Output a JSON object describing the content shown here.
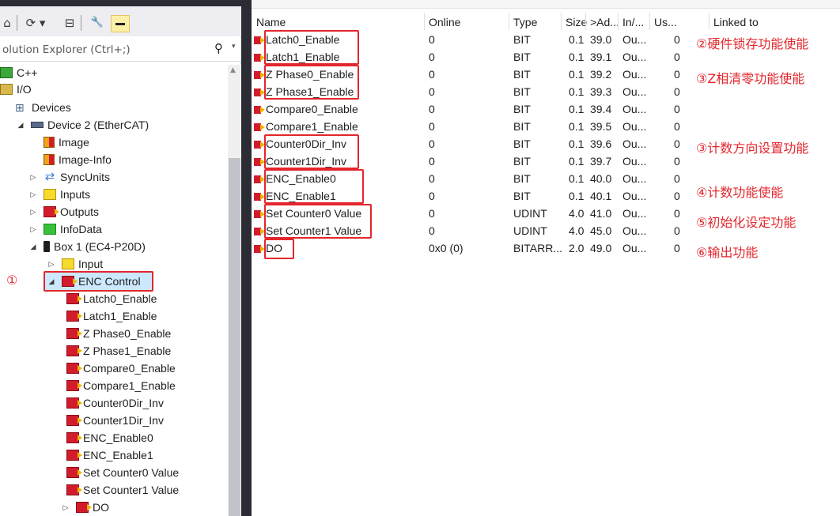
{
  "toolbar": {
    "home": "⌂",
    "history": "⟳ ▾",
    "collapse": "⊟",
    "properties": "🔧"
  },
  "search": {
    "placeholder": "olution Explorer (Ctrl+;)"
  },
  "tree": [
    {
      "label": "C++",
      "icon": "cpp-icon"
    },
    {
      "label": "I/O",
      "icon": "io-icon"
    },
    {
      "label": "Devices",
      "icon": "devices-icon"
    },
    {
      "label": "Device 2 (EtherCAT)",
      "icon": "device-icon"
    },
    {
      "label": "Image",
      "icon": "image-icon"
    },
    {
      "label": "Image-Info",
      "icon": "image-info-icon"
    },
    {
      "label": "SyncUnits",
      "icon": "sync-icon"
    },
    {
      "label": "Inputs",
      "icon": "inputs-icon"
    },
    {
      "label": "Outputs",
      "icon": "outputs-icon"
    },
    {
      "label": "InfoData",
      "icon": "infodata-icon"
    },
    {
      "label": "Box 1 (EC4-P20D)",
      "icon": "box-icon"
    },
    {
      "label": "Input",
      "icon": "input-icon"
    },
    {
      "label": "ENC Control",
      "icon": "enc-control-icon"
    },
    {
      "label": "Latch0_Enable",
      "icon": "output-var-icon"
    },
    {
      "label": "Latch1_Enable",
      "icon": "output-var-icon"
    },
    {
      "label": "Z Phase0_Enable",
      "icon": "output-var-icon"
    },
    {
      "label": "Z Phase1_Enable",
      "icon": "output-var-icon"
    },
    {
      "label": "Compare0_Enable",
      "icon": "output-var-icon"
    },
    {
      "label": "Compare1_Enable",
      "icon": "output-var-icon"
    },
    {
      "label": "Counter0Dir_Inv",
      "icon": "output-var-icon"
    },
    {
      "label": "Counter1Dir_Inv",
      "icon": "output-var-icon"
    },
    {
      "label": "ENC_Enable0",
      "icon": "output-var-icon"
    },
    {
      "label": "ENC_Enable1",
      "icon": "output-var-icon"
    },
    {
      "label": "Set Counter0 Value",
      "icon": "output-var-icon"
    },
    {
      "label": "Set Counter1 Value",
      "icon": "output-var-icon"
    },
    {
      "label": "DO",
      "icon": "output-var-icon"
    }
  ],
  "annotation_left": "①",
  "table": {
    "headers": [
      "Name",
      "Online",
      "Type",
      "Size",
      ">Ad...",
      "In/...",
      "Us...",
      "Linked to"
    ],
    "rows": [
      [
        "Latch0_Enable",
        "0",
        "BIT",
        "0.1",
        "39.0",
        "Ou...",
        "0"
      ],
      [
        "Latch1_Enable",
        "0",
        "BIT",
        "0.1",
        "39.1",
        "Ou...",
        "0"
      ],
      [
        "Z Phase0_Enable",
        "0",
        "BIT",
        "0.1",
        "39.2",
        "Ou...",
        "0"
      ],
      [
        "Z Phase1_Enable",
        "0",
        "BIT",
        "0.1",
        "39.3",
        "Ou...",
        "0"
      ],
      [
        "Compare0_Enable",
        "0",
        "BIT",
        "0.1",
        "39.4",
        "Ou...",
        "0"
      ],
      [
        "Compare1_Enable",
        "0",
        "BIT",
        "0.1",
        "39.5",
        "Ou...",
        "0"
      ],
      [
        "Counter0Dir_Inv",
        "0",
        "BIT",
        "0.1",
        "39.6",
        "Ou...",
        "0"
      ],
      [
        "Counter1Dir_Inv",
        "0",
        "BIT",
        "0.1",
        "39.7",
        "Ou...",
        "0"
      ],
      [
        "ENC_Enable0",
        "0",
        "BIT",
        "0.1",
        "40.0",
        "Ou...",
        "0"
      ],
      [
        "ENC_Enable1",
        "0",
        "BIT",
        "0.1",
        "40.1",
        "Ou...",
        "0"
      ],
      [
        "Set Counter0 Value",
        "0",
        "UDINT",
        "4.0",
        "41.0",
        "Ou...",
        "0"
      ],
      [
        "Set Counter1 Value",
        "0",
        "UDINT",
        "4.0",
        "45.0",
        "Ou...",
        "0"
      ],
      [
        "DO",
        "0x0 (0)",
        "BITARR...",
        "2.0",
        "49.0",
        "Ou...",
        "0"
      ]
    ]
  },
  "annotations_right": [
    "②硬件锁存功能使能",
    "③Z相清零功能使能",
    "③计数方向设置功能",
    "④计数功能使能",
    "⑤初始化设定功能",
    "⑥输出功能"
  ],
  "colors": {
    "highlight": "#e3262c",
    "selected": "#cce8ff"
  }
}
